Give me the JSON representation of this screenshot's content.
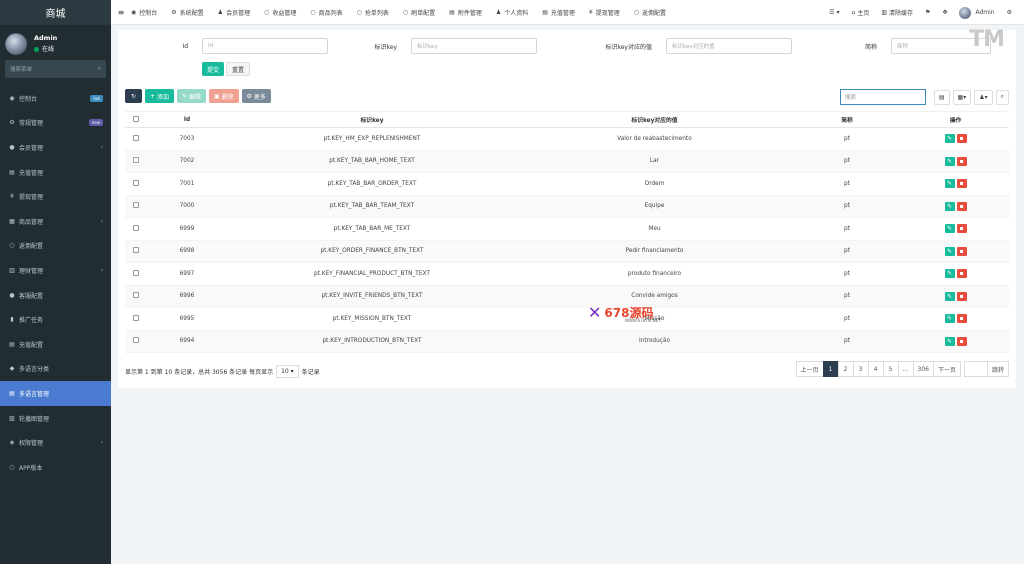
{
  "brand": "商城",
  "user": {
    "name": "Admin",
    "status": "在线"
  },
  "sidebar_search_placeholder": "搜索菜单",
  "menu": [
    {
      "icon": "dashboard-icon",
      "glyph": "◉",
      "label": "控制台",
      "badge": "hot",
      "badge_color": "blue"
    },
    {
      "icon": "cogs-icon",
      "glyph": "⚙",
      "label": "常规管理",
      "badge": "new",
      "badge_color": "purple"
    },
    {
      "icon": "user-circle-icon",
      "glyph": "●",
      "label": "会员管理",
      "arrow": "‹"
    },
    {
      "icon": "recharge-icon",
      "glyph": "▤",
      "label": "充值管理"
    },
    {
      "icon": "yen-icon",
      "glyph": "¥",
      "label": "提现管理"
    },
    {
      "icon": "product-icon",
      "glyph": "▦",
      "label": "商品管理",
      "arrow": "‹"
    },
    {
      "icon": "circle-icon",
      "glyph": "○",
      "label": "返佣配置"
    },
    {
      "icon": "finance-icon",
      "glyph": "▥",
      "label": "理财管理",
      "arrow": "‹"
    },
    {
      "icon": "support-icon",
      "glyph": "●",
      "label": "客服配置"
    },
    {
      "icon": "promote-icon",
      "glyph": "▮",
      "label": "推广任务"
    },
    {
      "icon": "recharge-config-icon",
      "glyph": "▤",
      "label": "充值配置"
    },
    {
      "icon": "language-category-icon",
      "glyph": "◆",
      "label": "多语言分类"
    },
    {
      "icon": "language-manage-icon",
      "glyph": "▤",
      "label": "多语言管理",
      "active": true
    },
    {
      "icon": "carousel-icon",
      "glyph": "▧",
      "label": "轮播图管理"
    },
    {
      "icon": "permission-icon",
      "glyph": "◈",
      "label": "权限管理",
      "arrow": "‹"
    },
    {
      "icon": "app-icon",
      "glyph": "○",
      "label": "APP版本"
    }
  ],
  "topnav": [
    {
      "icon": "dashboard-icon",
      "glyph": "◉",
      "label": "控制台"
    },
    {
      "icon": "cog-icon",
      "glyph": "⚙",
      "label": "系统配置"
    },
    {
      "icon": "user-icon",
      "glyph": "♟",
      "label": "会员管理"
    },
    {
      "icon": "circle-icon",
      "glyph": "○",
      "label": "收益管理"
    },
    {
      "icon": "circle-icon",
      "glyph": "○",
      "label": "商品列表"
    },
    {
      "icon": "circle-icon",
      "glyph": "○",
      "label": "抢单列表"
    },
    {
      "icon": "circle-icon",
      "glyph": "○",
      "label": "刷单配置"
    },
    {
      "icon": "file-icon",
      "glyph": "▤",
      "label": "附件管理"
    },
    {
      "icon": "user-icon",
      "glyph": "♟",
      "label": "个人资料"
    },
    {
      "icon": "recharge-icon",
      "glyph": "▤",
      "label": "充值管理"
    },
    {
      "icon": "yen-icon",
      "glyph": "¥",
      "label": "提现管理"
    },
    {
      "icon": "circle-icon",
      "glyph": "○",
      "label": "返佣配置"
    }
  ],
  "top_right": {
    "home": "主页",
    "clear_cache": "清除缓存",
    "admin": "Admin"
  },
  "watermark_tm": "TM",
  "filters": {
    "id_label": "Id",
    "id_placeholder": "Id",
    "key_label": "标识key",
    "key_placeholder": "标识key",
    "value_label": "标识key对应的值",
    "value_placeholder": "标识key对应的值",
    "abbr_label": "简称",
    "abbr_placeholder": "简称",
    "submit": "提交",
    "reset": "重置"
  },
  "toolbar": {
    "add": "添加",
    "edit": "编辑",
    "delete": "删除",
    "more": "更多",
    "search_placeholder": "搜索"
  },
  "table": {
    "headers": [
      "Id",
      "标识key",
      "标识key对应的值",
      "简称",
      "操作"
    ],
    "rows": [
      {
        "id": "7003",
        "key": "pt.KEY_HM_EXP_REPLENISHMENT",
        "value": "Valor de reabastecimento",
        "abbr": "pt"
      },
      {
        "id": "7002",
        "key": "pt.KEY_TAB_BAR_HOME_TEXT",
        "value": "Lar",
        "abbr": "pt"
      },
      {
        "id": "7001",
        "key": "pt.KEY_TAB_BAR_ORDER_TEXT",
        "value": "Ordem",
        "abbr": "pt"
      },
      {
        "id": "7000",
        "key": "pt.KEY_TAB_BAR_TEAM_TEXT",
        "value": "Equipe",
        "abbr": "pt"
      },
      {
        "id": "6999",
        "key": "pt.KEY_TAB_BAR_ME_TEXT",
        "value": "Meu",
        "abbr": "pt"
      },
      {
        "id": "6998",
        "key": "pt.KEY_ORDER_FINANCE_BTN_TEXT",
        "value": "Pedir financiamento",
        "abbr": "pt"
      },
      {
        "id": "6997",
        "key": "pt.KEY_FINANCIAL_PRODUCT_BTN_TEXT",
        "value": "produto financeiro",
        "abbr": "pt"
      },
      {
        "id": "6996",
        "key": "pt.KEY_INVITE_FRIENDS_BTN_TEXT",
        "value": "Convide amigos",
        "abbr": "pt"
      },
      {
        "id": "6995",
        "key": "pt.KEY_MISSION_BTN_TEXT",
        "value": "Missão",
        "abbr": "pt"
      },
      {
        "id": "6994",
        "key": "pt.KEY_INTRODUCTION_BTN_TEXT",
        "value": "Introdução",
        "abbr": "pt"
      }
    ]
  },
  "pagination": {
    "info_prefix": "显示第 1 到第 10 条记录，总共 3056 条记录 每页显示",
    "page_size": "10",
    "info_suffix": "条记录",
    "prev": "上一页",
    "pages": [
      "1",
      "2",
      "3",
      "4",
      "5",
      "...",
      "306"
    ],
    "active_page": "1",
    "next": "下一页",
    "go": "跳转"
  },
  "watermark": {
    "text": "678源码",
    "sub": "WWW.678YM.NET"
  }
}
